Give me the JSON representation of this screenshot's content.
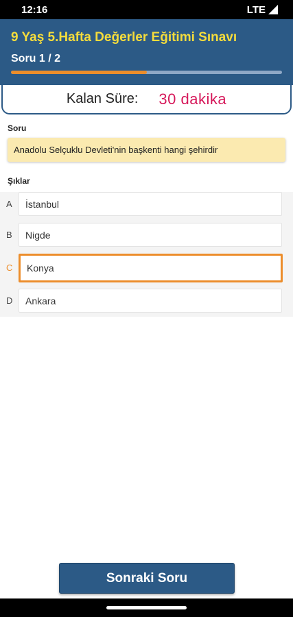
{
  "status_bar": {
    "time": "12:16",
    "network": "LTE"
  },
  "header": {
    "title": "9 Yaş 5.Hafta Değerler Eğitimi Sınavı",
    "question_counter": "Soru 1 / 2",
    "progress_fraction": 0.5,
    "colors": {
      "background": "#2c5a86",
      "title": "#f5dc3c",
      "progress": "#ec8d2b"
    }
  },
  "timer": {
    "label": "Kalan Süre:",
    "value": "30 dakika",
    "value_color": "#d6185a"
  },
  "question": {
    "section_label": "Soru",
    "text": "Anadolu Selçuklu Devleti'nin başkenti hangi şehirdir"
  },
  "options": {
    "section_label": "Şıklar",
    "selected": "C",
    "items": [
      {
        "letter": "A",
        "text": "İstanbul"
      },
      {
        "letter": "B",
        "text": "Nigde"
      },
      {
        "letter": "C",
        "text": "Konya"
      },
      {
        "letter": "D",
        "text": "Ankara"
      }
    ]
  },
  "next_button": {
    "label": "Sonraki Soru"
  }
}
